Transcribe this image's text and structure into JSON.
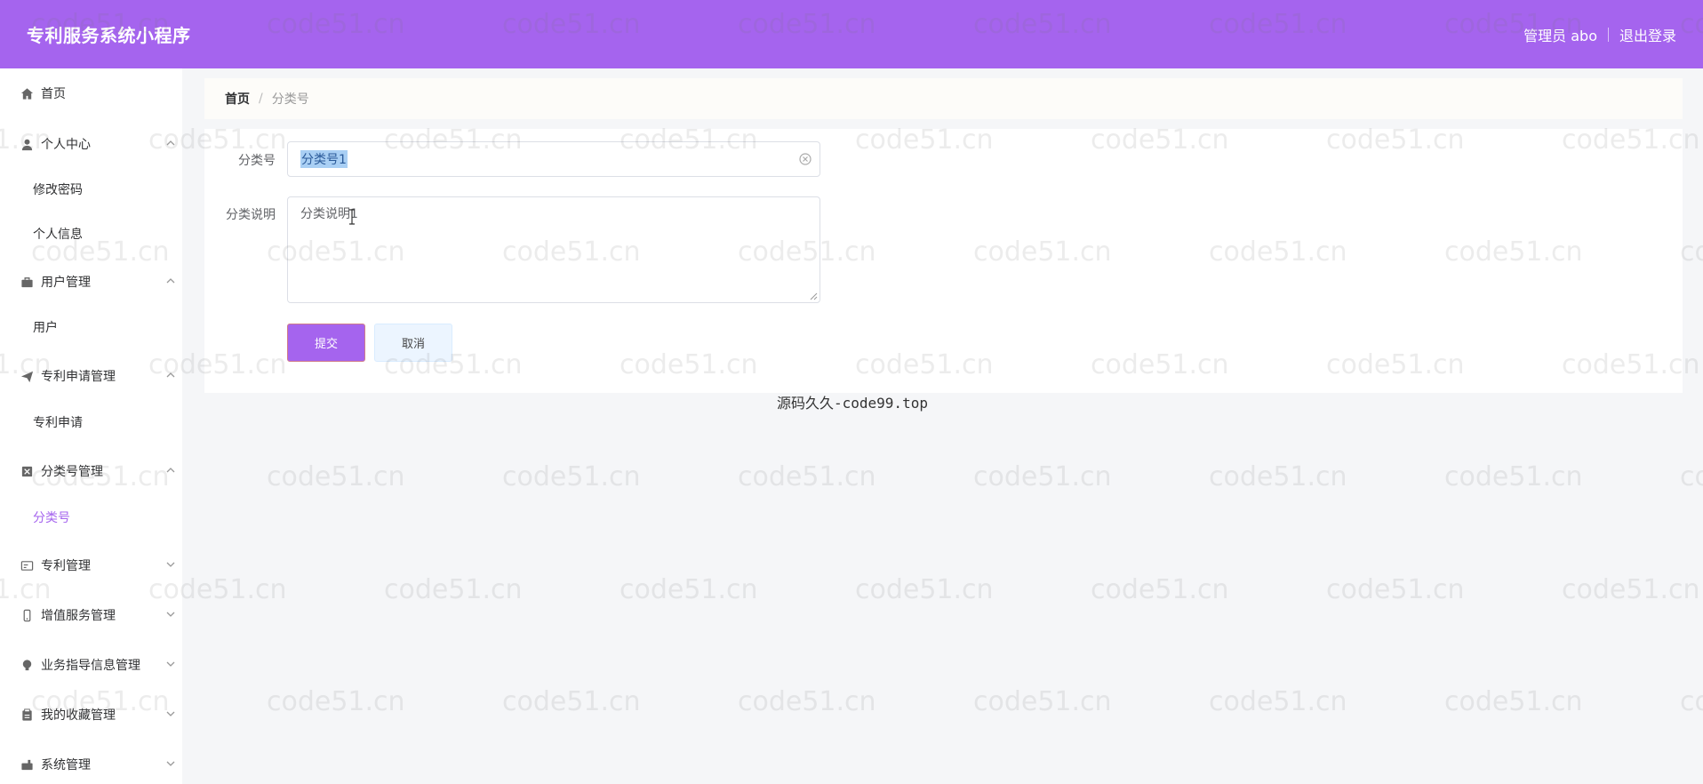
{
  "header": {
    "title": "专利服务系统小程序",
    "user": "管理员 abo",
    "logout": "退出登录"
  },
  "sidebar": {
    "items": [
      {
        "label": "首页",
        "icon": "home-icon"
      },
      {
        "label": "个人中心",
        "icon": "user-icon",
        "children": [
          "修改密码",
          "个人信息"
        ]
      },
      {
        "label": "用户管理",
        "icon": "briefcase-icon",
        "children": [
          "用户"
        ]
      },
      {
        "label": "专利申请管理",
        "icon": "send-icon",
        "children": [
          "专利申请"
        ]
      },
      {
        "label": "分类号管理",
        "icon": "box-icon",
        "children": [
          "分类号"
        ]
      },
      {
        "label": "专利管理",
        "icon": "card-icon"
      },
      {
        "label": "增值服务管理",
        "icon": "phone-icon"
      },
      {
        "label": "业务指导信息管理",
        "icon": "bulb-icon"
      },
      {
        "label": "我的收藏管理",
        "icon": "clipboard-icon"
      },
      {
        "label": "系统管理",
        "icon": "settings-icon"
      }
    ],
    "active": "分类号"
  },
  "breadcrumb": {
    "home": "首页",
    "separator": "/",
    "current": "分类号"
  },
  "form": {
    "field1_label": "分类号",
    "field1_value": "分类号1",
    "field2_label": "分类说明",
    "field2_value": "分类说明1",
    "submit": "提交",
    "cancel": "取消"
  },
  "footer_note": "源码久久-code99.top",
  "watermark": "code51.cn",
  "colors": {
    "primary": "#a564ee",
    "header_bg": "#a564ee"
  }
}
